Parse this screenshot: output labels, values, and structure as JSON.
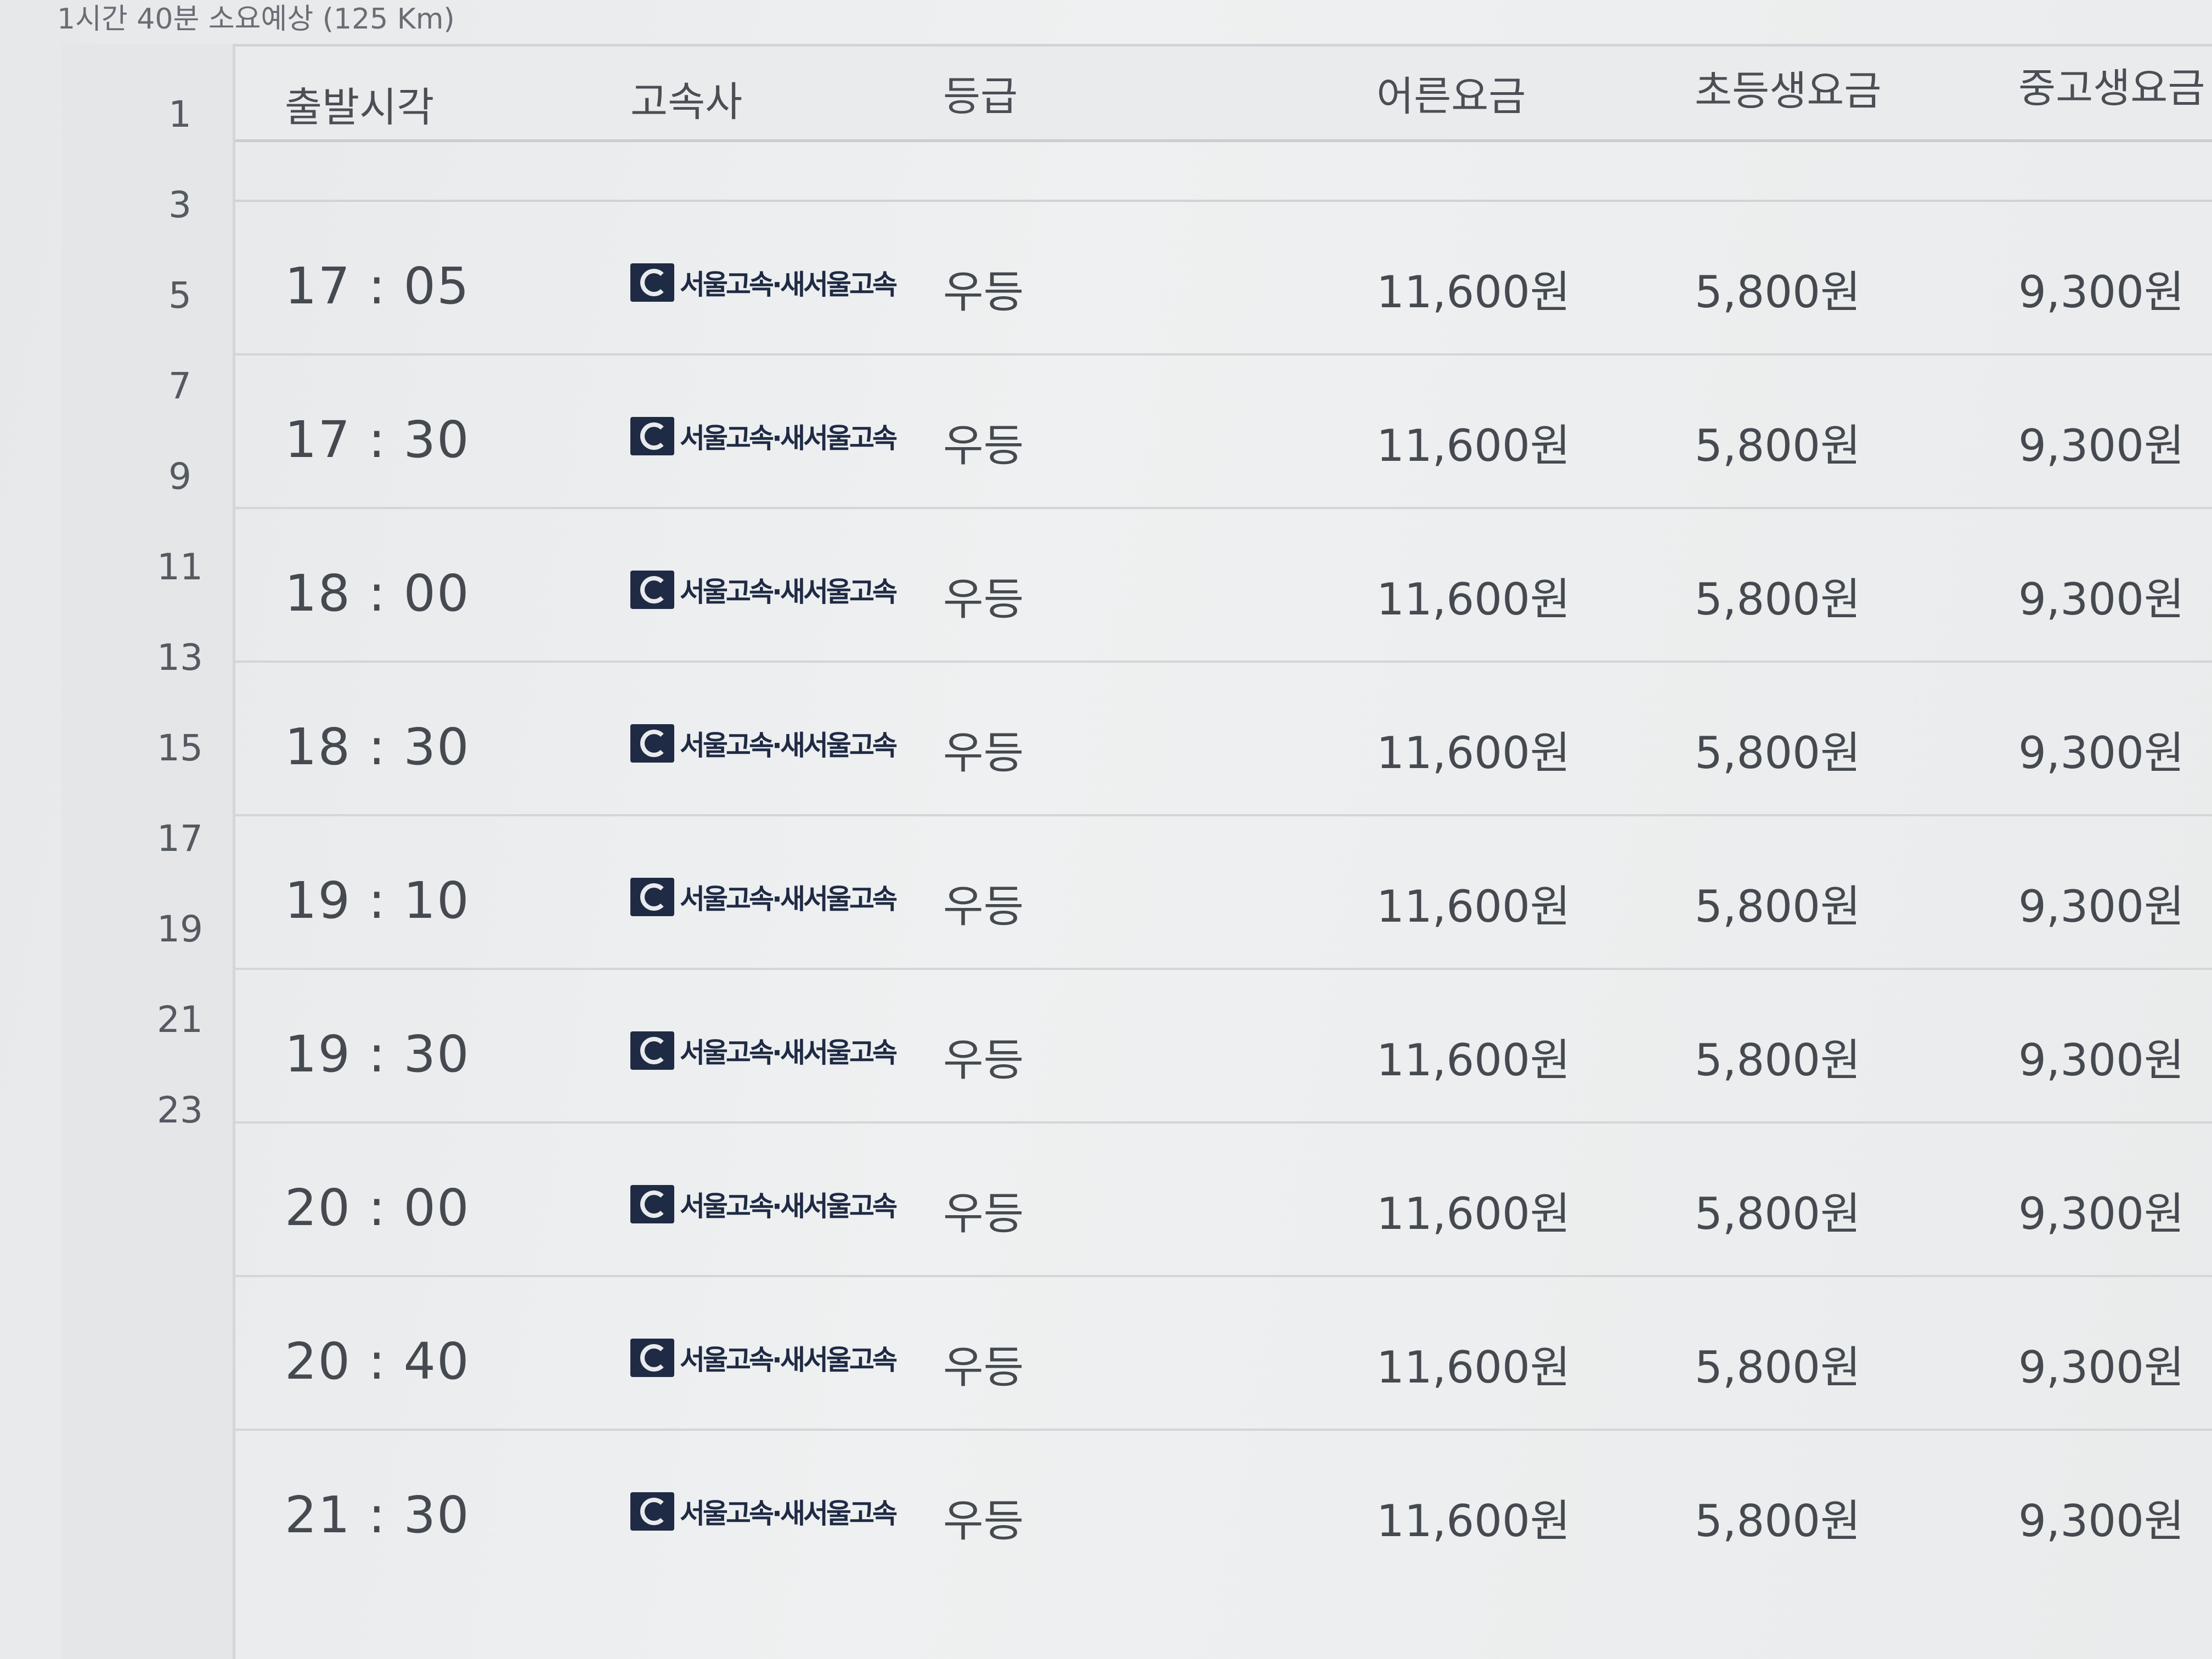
{
  "summary": "1시간 40분 소요예상 (125 Km)",
  "line_numbers": [
    "1",
    "3",
    "5",
    "7",
    "9",
    "11",
    "13",
    "15",
    "17",
    "19",
    "21",
    "23"
  ],
  "headers": {
    "departure": "출발시각",
    "company": "고속사",
    "grade": "등급",
    "adult_fare": "어른요금",
    "child_fare": "초등생요금",
    "teen_fare": "중고생요금"
  },
  "schedule": [
    {
      "time": "17 : 05",
      "company": "서울고속·새서울고속",
      "grade": "우등",
      "adult": "11,600원",
      "child": "5,800원",
      "teen": "9,300원"
    },
    {
      "time": "17 : 30",
      "company": "서울고속·새서울고속",
      "grade": "우등",
      "adult": "11,600원",
      "child": "5,800원",
      "teen": "9,300원"
    },
    {
      "time": "18 : 00",
      "company": "서울고속·새서울고속",
      "grade": "우등",
      "adult": "11,600원",
      "child": "5,800원",
      "teen": "9,300원"
    },
    {
      "time": "18 : 30",
      "company": "서울고속·새서울고속",
      "grade": "우등",
      "adult": "11,600원",
      "child": "5,800원",
      "teen": "9,300원"
    },
    {
      "time": "19 : 10",
      "company": "서울고속·새서울고속",
      "grade": "우등",
      "adult": "11,600원",
      "child": "5,800원",
      "teen": "9,300원"
    },
    {
      "time": "19 : 30",
      "company": "서울고속·새서울고속",
      "grade": "우등",
      "adult": "11,600원",
      "child": "5,800원",
      "teen": "9,300원"
    },
    {
      "time": "20 : 00",
      "company": "서울고속·새서울고속",
      "grade": "우등",
      "adult": "11,600원",
      "child": "5,800원",
      "teen": "9,300원"
    },
    {
      "time": "20 : 40",
      "company": "서울고속·새서울고속",
      "grade": "우등",
      "adult": "11,600원",
      "child": "5,800원",
      "teen": "9,300원"
    },
    {
      "time": "21 : 30",
      "company": "서울고속·새서울고속",
      "grade": "우등",
      "adult": "11,600원",
      "child": "5,800원",
      "teen": "9,300원"
    }
  ]
}
